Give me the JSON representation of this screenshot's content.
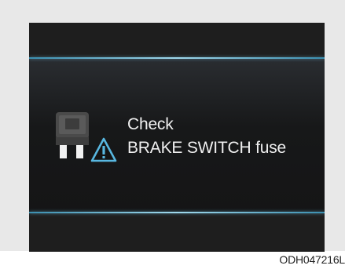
{
  "message": {
    "line1": "Check",
    "line2": "BRAKE SWITCH fuse"
  },
  "icons": {
    "fuse": "fuse-icon",
    "warning": "warning-triangle-icon"
  },
  "colors": {
    "accent_line": "#9fd8ec",
    "warning_outline": "#58b7e0",
    "text": "#f0f0f0",
    "screen_background": "#1e1e1e"
  },
  "caption": "ODH047216L"
}
